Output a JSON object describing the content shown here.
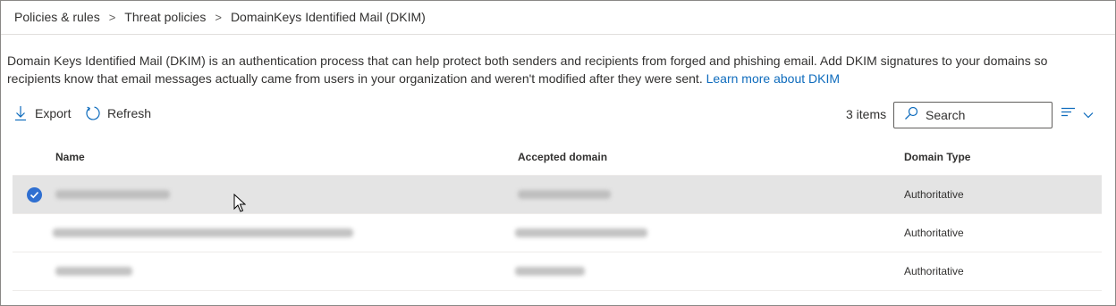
{
  "breadcrumb": {
    "items": [
      "Policies & rules",
      "Threat policies",
      "DomainKeys Identified Mail (DKIM)"
    ],
    "separator": ">"
  },
  "description": {
    "text": "Domain Keys Identified Mail (DKIM) is an authentication process that can help protect both senders and recipients from forged and phishing email. Add DKIM signatures to your domains so recipients know that email messages actually came from users in your organization and weren't modified after they were sent.",
    "link": "Learn more about DKIM"
  },
  "toolbar": {
    "export_label": "Export",
    "refresh_label": "Refresh",
    "items_count": "3 items",
    "search_placeholder": "Search",
    "group_icon": "group-lines-icon"
  },
  "table": {
    "columns": [
      "Name",
      "Accepted domain",
      "Domain Type"
    ],
    "rows": [
      {
        "selected": true,
        "domain_type": "Authoritative"
      },
      {
        "selected": false,
        "domain_type": "Authoritative"
      },
      {
        "selected": false,
        "domain_type": "Authoritative"
      }
    ]
  },
  "colors": {
    "accent": "#0f6cbd",
    "selected_row": "#e4e4e4",
    "check": "#2f6fd1"
  }
}
